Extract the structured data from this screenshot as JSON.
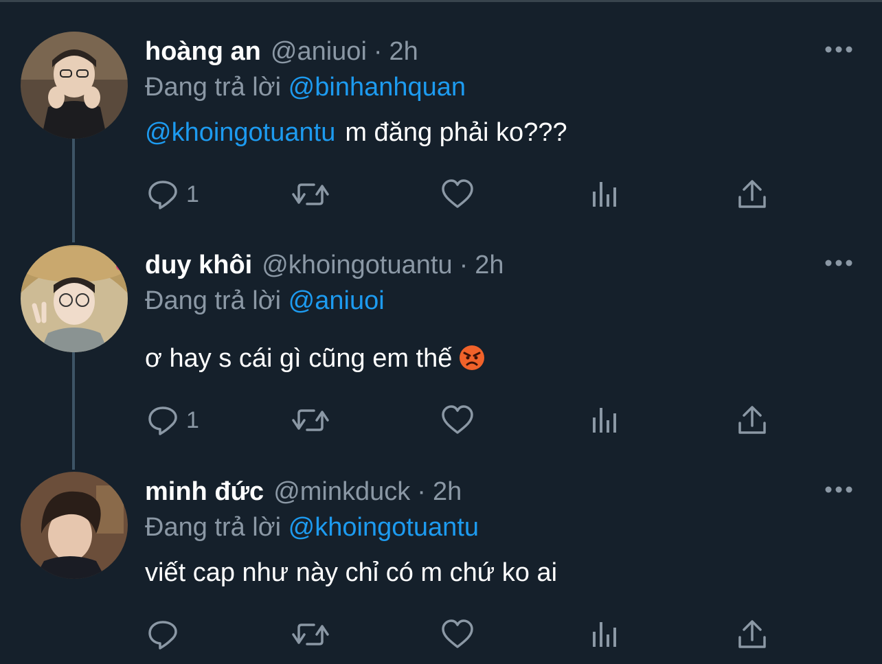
{
  "tweets": [
    {
      "name": "hoàng an",
      "handle": "@aniuoi",
      "separator": "·",
      "time": "2h",
      "replying_prefix": "Đang trả lời",
      "replying_to": "@binhanhquan",
      "mention": "@khoingotuantu",
      "text": "m đăng phải ko???",
      "reply_count": "1",
      "avatar_icon": "user-avatar"
    },
    {
      "name": "duy khôi",
      "handle": "@khoingotuantu",
      "separator": "·",
      "time": "2h",
      "replying_prefix": "Đang trả lời",
      "replying_to": "@aniuoi",
      "text": "ơ hay s cái gì cũng em thế",
      "emoji": "angry-face-emoji",
      "reply_count": "1",
      "avatar_icon": "user-avatar"
    },
    {
      "name": "minh đức",
      "handle": "@minkduck",
      "separator": "·",
      "time": "2h",
      "replying_prefix": "Đang trả lời",
      "replying_to": "@khoingotuantu",
      "text": "viết cap như này chỉ có m chứ ko ai",
      "reply_count": "",
      "avatar_icon": "user-avatar"
    }
  ],
  "icons": {
    "reply": "reply-icon",
    "retweet": "retweet-icon",
    "like": "heart-icon",
    "views": "views-icon",
    "share": "share-icon",
    "more": "more-options-icon"
  },
  "colors": {
    "background": "#15202b",
    "primary_text": "#ffffff",
    "secondary_text": "#8b98a5",
    "accent": "#1d9bf0",
    "thread_line": "#3d5466"
  }
}
